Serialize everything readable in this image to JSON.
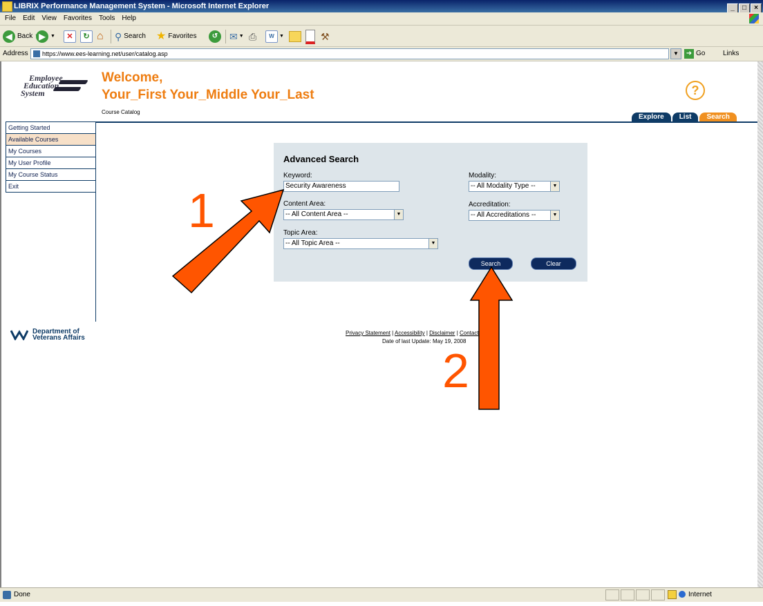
{
  "window": {
    "title": "LIBRIX Performance Management System - Microsoft Internet Explorer",
    "controls": [
      "_",
      "□",
      "×"
    ]
  },
  "menu": [
    "File",
    "Edit",
    "View",
    "Favorites",
    "Tools",
    "Help"
  ],
  "toolbar": {
    "back_label": "Back",
    "search_label": "Search",
    "favorites_label": "Favorites"
  },
  "address": {
    "label": "Address",
    "url": "https://www.ees-learning.net/user/catalog.asp",
    "go_label": "Go",
    "links_label": "Links"
  },
  "header": {
    "logo_lines": [
      "Employee",
      "Education",
      "System"
    ],
    "welcome": "Welcome,",
    "user_name": "Your_First Your_Middle Your_Last",
    "breadcrumb": "Course Catalog",
    "help_symbol": "?",
    "tabs": [
      {
        "label": "Explore",
        "active": false
      },
      {
        "label": "List",
        "active": false
      },
      {
        "label": "Search",
        "active": true
      }
    ]
  },
  "sidebar": {
    "items": [
      {
        "label": "Getting Started"
      },
      {
        "label": "Available Courses",
        "active": true
      },
      {
        "label": "My Courses"
      },
      {
        "label": "My User Profile"
      },
      {
        "label": "My Course Status"
      },
      {
        "label": "Exit"
      }
    ]
  },
  "search": {
    "title": "Advanced Search",
    "keyword_label": "Keyword:",
    "keyword_value": "Security Awareness",
    "content_area_label": "Content Area:",
    "content_area_value": "-- All Content Area --",
    "topic_area_label": "Topic Area:",
    "topic_area_value": "-- All Topic Area --",
    "modality_label": "Modality:",
    "modality_value": "-- All Modality Type --",
    "accreditation_label": "Accreditation:",
    "accreditation_value": "-- All Accreditations --",
    "search_button": "Search",
    "clear_button": "Clear"
  },
  "annotations": {
    "step1": "1",
    "step2": "2",
    "arrow_color": "#ff5500"
  },
  "footer": {
    "va_line1": "Department of",
    "va_line2": "Veterans Affairs",
    "privacy": "Privacy Statement",
    "accessibility": "Accessibility",
    "disclaimer": "Disclaimer",
    "contact": "Contact EES",
    "date_prefix": "Date of last Update:",
    "date": "May 19, 2008"
  },
  "status": {
    "text": "Done",
    "zone": "Internet"
  },
  "colors": {
    "accent_orange": "#ee7d11",
    "navy": "#0e3b66",
    "panel_bg": "#dde5ea"
  }
}
